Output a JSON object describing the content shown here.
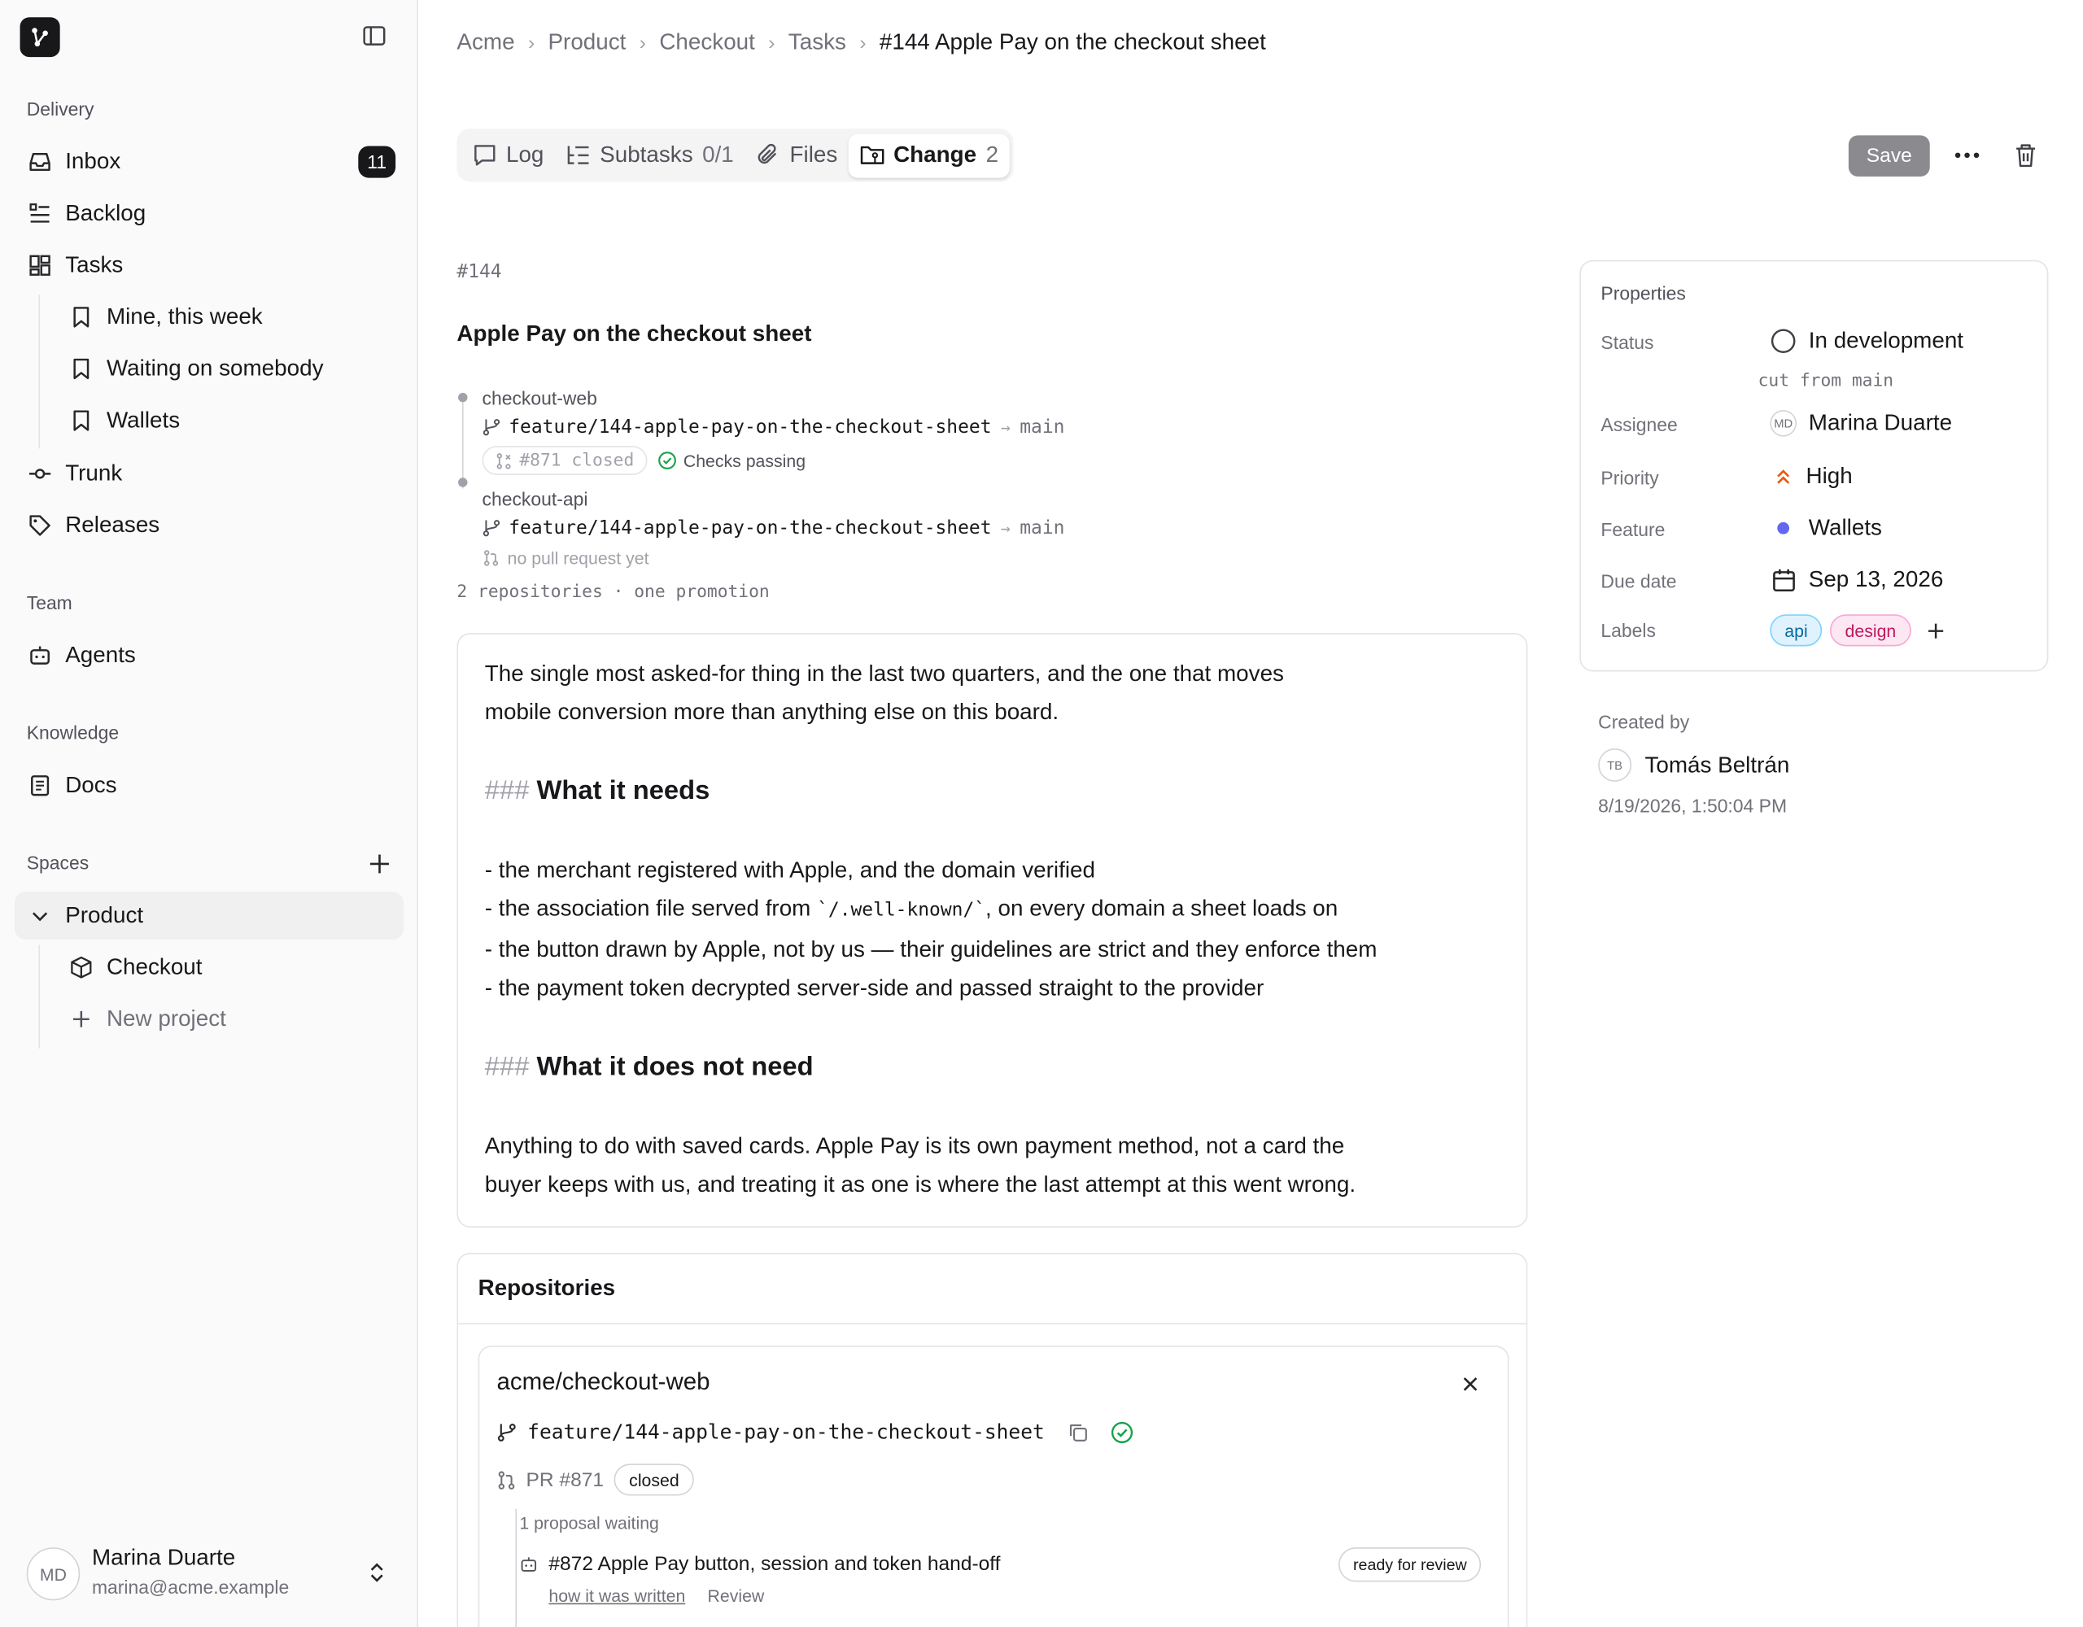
{
  "sidebar": {
    "sections": {
      "delivery": "Delivery",
      "team": "Team",
      "knowledge": "Knowledge",
      "spaces": "Spaces"
    },
    "items": {
      "inbox": {
        "label": "Inbox",
        "badge": "11"
      },
      "backlog": {
        "label": "Backlog"
      },
      "tasks": {
        "label": "Tasks"
      },
      "mine": {
        "label": "Mine, this week"
      },
      "waiting": {
        "label": "Waiting on somebody"
      },
      "wallets": {
        "label": "Wallets"
      },
      "trunk": {
        "label": "Trunk"
      },
      "releases": {
        "label": "Releases"
      },
      "agents": {
        "label": "Agents"
      },
      "docs": {
        "label": "Docs"
      },
      "product": {
        "label": "Product"
      },
      "checkout": {
        "label": "Checkout"
      },
      "new_project": {
        "label": "New project"
      }
    },
    "user": {
      "initials": "MD",
      "name": "Marina Duarte",
      "email": "marina@acme.example"
    }
  },
  "breadcrumb": [
    "Acme",
    "Product",
    "Checkout",
    "Tasks",
    "#144 Apple Pay on the checkout sheet"
  ],
  "tabs": {
    "log": {
      "label": "Log"
    },
    "subtasks": {
      "label": "Subtasks",
      "count": "0/1"
    },
    "files": {
      "label": "Files"
    },
    "change": {
      "label": "Change",
      "count": "2"
    }
  },
  "toolbar": {
    "save_label": "Save"
  },
  "task": {
    "id": "#144",
    "title": "Apple Pay on the checkout sheet"
  },
  "change": {
    "repos": [
      {
        "name": "checkout-web",
        "branch": "feature/144-apple-pay-on-the-checkout-sheet",
        "arrow": "→",
        "target": "main",
        "pr": "#871 closed",
        "checks": "Checks passing"
      },
      {
        "name": "checkout-api",
        "branch": "feature/144-apple-pay-on-the-checkout-sheet",
        "arrow": "→",
        "target": "main",
        "no_pr": "no pull request yet"
      }
    ],
    "summary": "2 repositories · one promotion"
  },
  "description": {
    "p1a": "The single most asked-for thing in the last two quarters, and the one that moves",
    "p1b": "mobile conversion more than anything else on this board.",
    "h1_hash": "###",
    "h1": "What it needs",
    "li1": "- the merchant registered with Apple, and the domain verified",
    "li2_pre": "- the association file served from ",
    "li2_code": "`/.well-known/`",
    "li2_post": ", on every domain a sheet loads on",
    "li3": "- the button drawn by Apple, not by us — their guidelines are strict and they enforce them",
    "li4": "- the payment token decrypted server-side and passed straight to the provider",
    "h2_hash": "###",
    "h2": "What it does not need",
    "p2a": "Anything to do with saved cards. Apple Pay is its own payment method, not a card the",
    "p2b": "buyer keeps with us, and treating it as one is where the last attempt at this went wrong."
  },
  "repositories": {
    "title": "Repositories",
    "card": {
      "name": "acme/checkout-web",
      "branch": "feature/144-apple-pay-on-the-checkout-sheet",
      "pr": "PR #871",
      "pr_status": "closed",
      "proposal_label": "1 proposal waiting",
      "proposal_title": "#872 Apple Pay button, session and token hand-off",
      "proposal_status": "ready for review",
      "link_how": "how it was written",
      "link_review": "Review"
    }
  },
  "properties": {
    "title": "Properties",
    "status": {
      "label": "Status",
      "value": "In development",
      "note": "cut from main"
    },
    "assignee": {
      "label": "Assignee",
      "initials": "MD",
      "value": "Marina Duarte"
    },
    "priority": {
      "label": "Priority",
      "value": "High"
    },
    "feature": {
      "label": "Feature",
      "value": "Wallets",
      "color": "#6366f1"
    },
    "due": {
      "label": "Due date",
      "value": "Sep 13, 2026"
    },
    "labels": {
      "label": "Labels",
      "items": [
        "api",
        "design"
      ]
    }
  },
  "created": {
    "label": "Created by",
    "initials": "TB",
    "name": "Tomás Beltrán",
    "when": "8/19/2026, 1:50:04 PM"
  }
}
